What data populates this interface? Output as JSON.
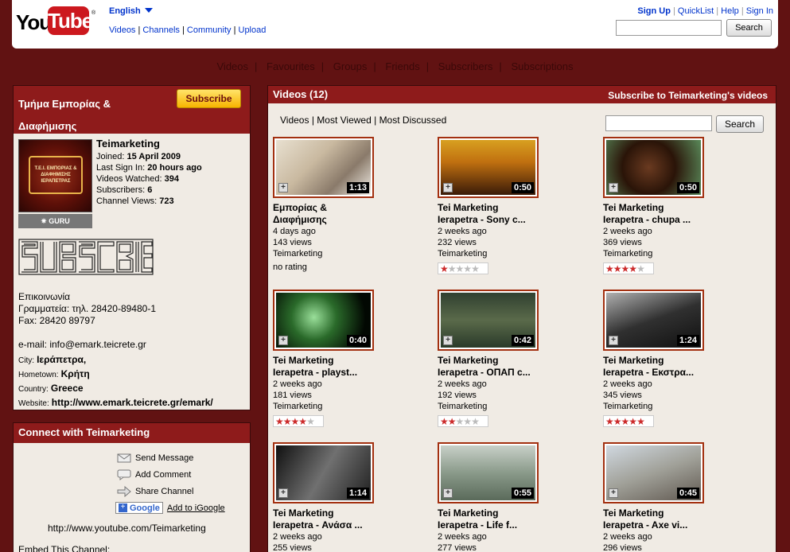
{
  "header": {
    "logo_you": "You",
    "logo_tube": "Tube",
    "logo_tm": "®",
    "language": "English",
    "nav": [
      "Videos",
      "Channels",
      "Community",
      "Upload"
    ],
    "links": [
      "Sign Up",
      "QuickList",
      "Help",
      "Sign In"
    ],
    "search_button": "Search"
  },
  "channel_nav": [
    "Videos",
    "Favourites",
    "Groups",
    "Friends",
    "Subscribers",
    "Subscriptions"
  ],
  "profile": {
    "title": "Τμήμα Εμπορίας & Διαφήμισης",
    "subscribe_button": "Subscribe",
    "badge": "✷ GURU",
    "avatar_text": "T.E.I. ΕΜΠΟΡΙΑΣ & ΔΙΑΦΗΜΙΣΗΣ ΙΕΡΑΠΕΤΡΑΣ",
    "username": "Teimarketing",
    "joined_label": "Joined:",
    "joined": "15 April 2009",
    "last_sign_in_label": "Last Sign In:",
    "last_sign_in": "20 hours ago",
    "videos_watched_label": "Videos Watched:",
    "videos_watched": "394",
    "subscribers_label": "Subscribers:",
    "subscribers": "6",
    "channel_views_label": "Channel Views:",
    "channel_views": "723",
    "subscribe_art": "SUBSCRIBE",
    "contact_heading": "Επικοινωνία",
    "contact_phone": "Γραμματεία: τηλ. 28420-89480-1",
    "contact_fax": "Fax: 28420 89797",
    "contact_email": "e-mail: info@emark.teicrete.gr",
    "city_label": "City:",
    "city": "Ιεράπετρα,",
    "hometown_label": "Hometown:",
    "hometown": "Κρήτη",
    "country_label": "Country:",
    "country": "Greece",
    "website_label": "Website:",
    "website": "http://www.emark.teicrete.gr/emark/"
  },
  "connect": {
    "title": "Connect with Teimarketing",
    "send_message": "Send Message",
    "add_comment": "Add Comment",
    "share_channel": "Share Channel",
    "google_label": "Google",
    "add_igoogle": "Add to iGoogle",
    "channel_url": "http://www.youtube.com/Teimarketing",
    "embed": "Embed This Channel:"
  },
  "videos": {
    "title": "Videos (12)",
    "subscribe_link": "Subscribe to Teimarketing's videos",
    "tabs": [
      "Videos",
      "Most Viewed",
      "Most Discussed"
    ],
    "search_button": "Search",
    "items": [
      {
        "line1": "Εμπορίας &",
        "line2": "Διαφήμισης",
        "duration": "1:13",
        "age": "4 days ago",
        "views": "143 views",
        "user": "Teimarketing",
        "rating": 0,
        "rating_text": "no rating"
      },
      {
        "line1": "Tei Marketing",
        "line2": "Ierapetra - Sony c...",
        "duration": "0:50",
        "age": "2 weeks ago",
        "views": "232 views",
        "user": "Teimarketing",
        "rating": 1
      },
      {
        "line1": "Tei Marketing",
        "line2": "Ierapetra - chupa ...",
        "duration": "0:50",
        "age": "2 weeks ago",
        "views": "369 views",
        "user": "Teimarketing",
        "rating": 3.5
      },
      {
        "line1": "Tei Marketing",
        "line2": "Ierapetra - playst...",
        "duration": "0:40",
        "age": "2 weeks ago",
        "views": "181 views",
        "user": "Teimarketing",
        "rating": 4
      },
      {
        "line1": "Tei Marketing",
        "line2": "Ierapetra - ΟΠΑΠ c...",
        "duration": "0:42",
        "age": "2 weeks ago",
        "views": "192 views",
        "user": "Teimarketing",
        "rating": 2
      },
      {
        "line1": "Tei Marketing",
        "line2": "Ierapetra - Εκστρα...",
        "duration": "1:24",
        "age": "2 weeks ago",
        "views": "345 views",
        "user": "Teimarketing",
        "rating": 5
      },
      {
        "line1": "Tei Marketing",
        "line2": "Ierapetra - Ανάσα ...",
        "duration": "1:14",
        "age": "2 weeks ago",
        "views": "255 views",
        "user": "",
        "rating": null
      },
      {
        "line1": "Tei Marketing",
        "line2": "Ierapetra - Life f...",
        "duration": "0:55",
        "age": "2 weeks ago",
        "views": "277 views",
        "user": "",
        "rating": null
      },
      {
        "line1": "Tei Marketing",
        "line2": "Ierapetra - Axe vi...",
        "duration": "0:45",
        "age": "2 weeks ago",
        "views": "296 views",
        "user": "",
        "rating": null
      }
    ]
  },
  "colors": {
    "background": "#611212",
    "header_bar": "#8e1b1b",
    "panel": "#f0ebe4",
    "link": "#0033cc",
    "star": "#cc2b2b"
  }
}
